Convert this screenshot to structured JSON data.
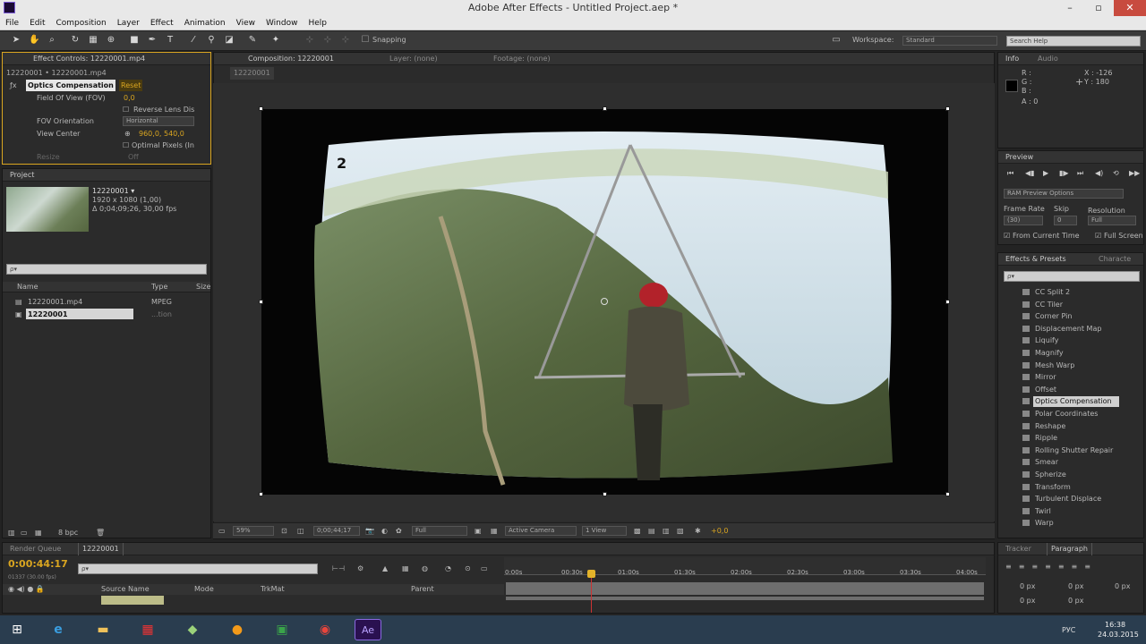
{
  "window": {
    "title": "Adobe After Effects - Untitled Project.aep *",
    "app_icon": "Ae"
  },
  "menu": [
    "File",
    "Edit",
    "Composition",
    "Layer",
    "Effect",
    "Animation",
    "View",
    "Window",
    "Help"
  ],
  "toolbar": {
    "snapping_label": "Snapping",
    "workspace_label": "Workspace:",
    "workspace_value": "Standard",
    "search_placeholder": "Search Help"
  },
  "effect_controls": {
    "tab_label": "Effect Controls: 12220001.mp4",
    "breadcrumb": "12220001 • 12220001.mp4",
    "effect_name": "Optics Compensation",
    "reset_label": "Reset",
    "props": [
      {
        "label": "Field Of View (FOV)",
        "value": "0,0"
      },
      {
        "label": "",
        "value": "Reverse Lens Dis"
      },
      {
        "label": "FOV Orientation",
        "value": "Horizontal"
      },
      {
        "label": "View Center",
        "value": "960,0, 540,0"
      },
      {
        "label": "",
        "value": "Optimal Pixels (In"
      },
      {
        "label": "Resize",
        "value": "Off"
      }
    ]
  },
  "project": {
    "tab_label": "Project",
    "item_name": "12220001 ▾",
    "item_info_1": "1920 x 1080 (1,00)",
    "item_info_2": "Δ 0;04;09;26, 30,00 fps",
    "search_placeholder": "ρ▾",
    "columns": [
      "Name",
      "Type",
      "Size"
    ],
    "rows": [
      {
        "name": "12220001.mp4",
        "type": "MPEG"
      },
      {
        "name": "12220001",
        "type": "...tion"
      }
    ],
    "bpc": "8 bpc"
  },
  "composition": {
    "tab_label": "Composition: 12220001",
    "layer_tab": "Layer: (none)",
    "footage_tab": "Footage: (none)",
    "sub_tab": "12220001",
    "frame_number": "2",
    "zoom": "59%",
    "timecode": "0;00;44;17",
    "resolution": "Full",
    "camera": "Active Camera",
    "view": "1 View",
    "exposure": "+0,0"
  },
  "info": {
    "tab_label": "Info",
    "audio_tab": "Audio",
    "r": "R :",
    "g": "G :",
    "b": "B :",
    "a": "A : 0",
    "x": "X : -126",
    "y": "Y : 180"
  },
  "preview": {
    "tab_label": "Preview",
    "ram_options": "RAM Preview Options",
    "frame_rate_label": "Frame Rate",
    "skip_label": "Skip",
    "resolution_label": "Resolution",
    "frame_rate": "(30)",
    "skip": "0",
    "resolution": "Full",
    "from_current": "From Current Time",
    "full_screen": "Full Screen"
  },
  "effects_presets": {
    "tab_label": "Effects & Presets",
    "char_tab": "Characte",
    "search_placeholder": "ρ▾",
    "items": [
      "CC Split 2",
      "CC Tiler",
      "Corner Pin",
      "Displacement Map",
      "Liquify",
      "Magnify",
      "Mesh Warp",
      "Mirror",
      "Offset",
      "Optics Compensation",
      "Polar Coordinates",
      "Reshape",
      "Ripple",
      "Rolling Shutter Repair",
      "Smear",
      "Spherize",
      "Transform",
      "Turbulent Displace",
      "Twirl",
      "Warp"
    ],
    "selected": "Optics Compensation"
  },
  "timeline": {
    "render_tab": "Render Queue",
    "comp_tab": "12220001",
    "timecode": "0:00:44:17",
    "frame_info": "01337 (30.00 fps)",
    "search_placeholder": "ρ▾",
    "ruler": [
      "0:00s",
      "00:30s",
      "01:00s",
      "01:30s",
      "02:00s",
      "02:30s",
      "03:00s",
      "03:30s",
      "04:00s"
    ],
    "col_source": "Source Name",
    "col_mode": "Mode",
    "col_trkmat": "TrkMat",
    "col_parent": "Parent"
  },
  "paragraph": {
    "tracker_tab": "Tracker",
    "paragraph_tab": "Paragraph",
    "v1": "0 px",
    "v2": "0 px",
    "v3": "0 px",
    "v4": "0 px",
    "v5": "0 px"
  },
  "taskbar": {
    "lang": "РУС",
    "time": "16:38",
    "date": "24.03.2015",
    "ae_label": "Ae"
  }
}
